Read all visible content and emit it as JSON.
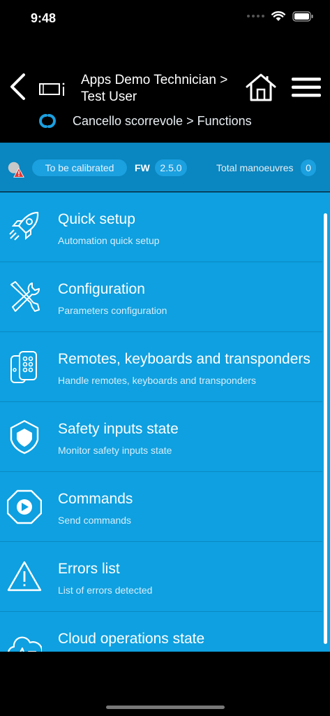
{
  "status_bar": {
    "time": "9:48"
  },
  "header": {
    "title": "Apps Demo Technician > Test User",
    "breadcrumb": "Cancello scorrevole > Functions"
  },
  "info_bar": {
    "calibration_status": "To be calibrated",
    "fw_label": "FW",
    "fw_version": "2.5.0",
    "manoeuvres_label": "Total manoeuvres",
    "manoeuvres_count": "0"
  },
  "colors": {
    "accent": "#0ea0e0",
    "info_bar": "#0a86c0",
    "pill": "#1ba0e0",
    "warning": "#e53935"
  },
  "menu_items": [
    {
      "icon": "rocket-icon",
      "title": "Quick setup",
      "subtitle": "Automation quick setup"
    },
    {
      "icon": "tools-icon",
      "title": "Configuration",
      "subtitle": "Parameters configuration"
    },
    {
      "icon": "remote-control-icon",
      "title": "Remotes, keyboards and transponders",
      "subtitle": "Handle remotes, keyboards and transponders"
    },
    {
      "icon": "shield-icon",
      "title": "Safety inputs state",
      "subtitle": "Monitor safety inputs state"
    },
    {
      "icon": "play-command-icon",
      "title": "Commands",
      "subtitle": "Send commands"
    },
    {
      "icon": "warning-icon",
      "title": "Errors list",
      "subtitle": "List of errors detected"
    },
    {
      "icon": "cloud-heartbeat-icon",
      "title": "Cloud operations state",
      "subtitle": ""
    }
  ]
}
